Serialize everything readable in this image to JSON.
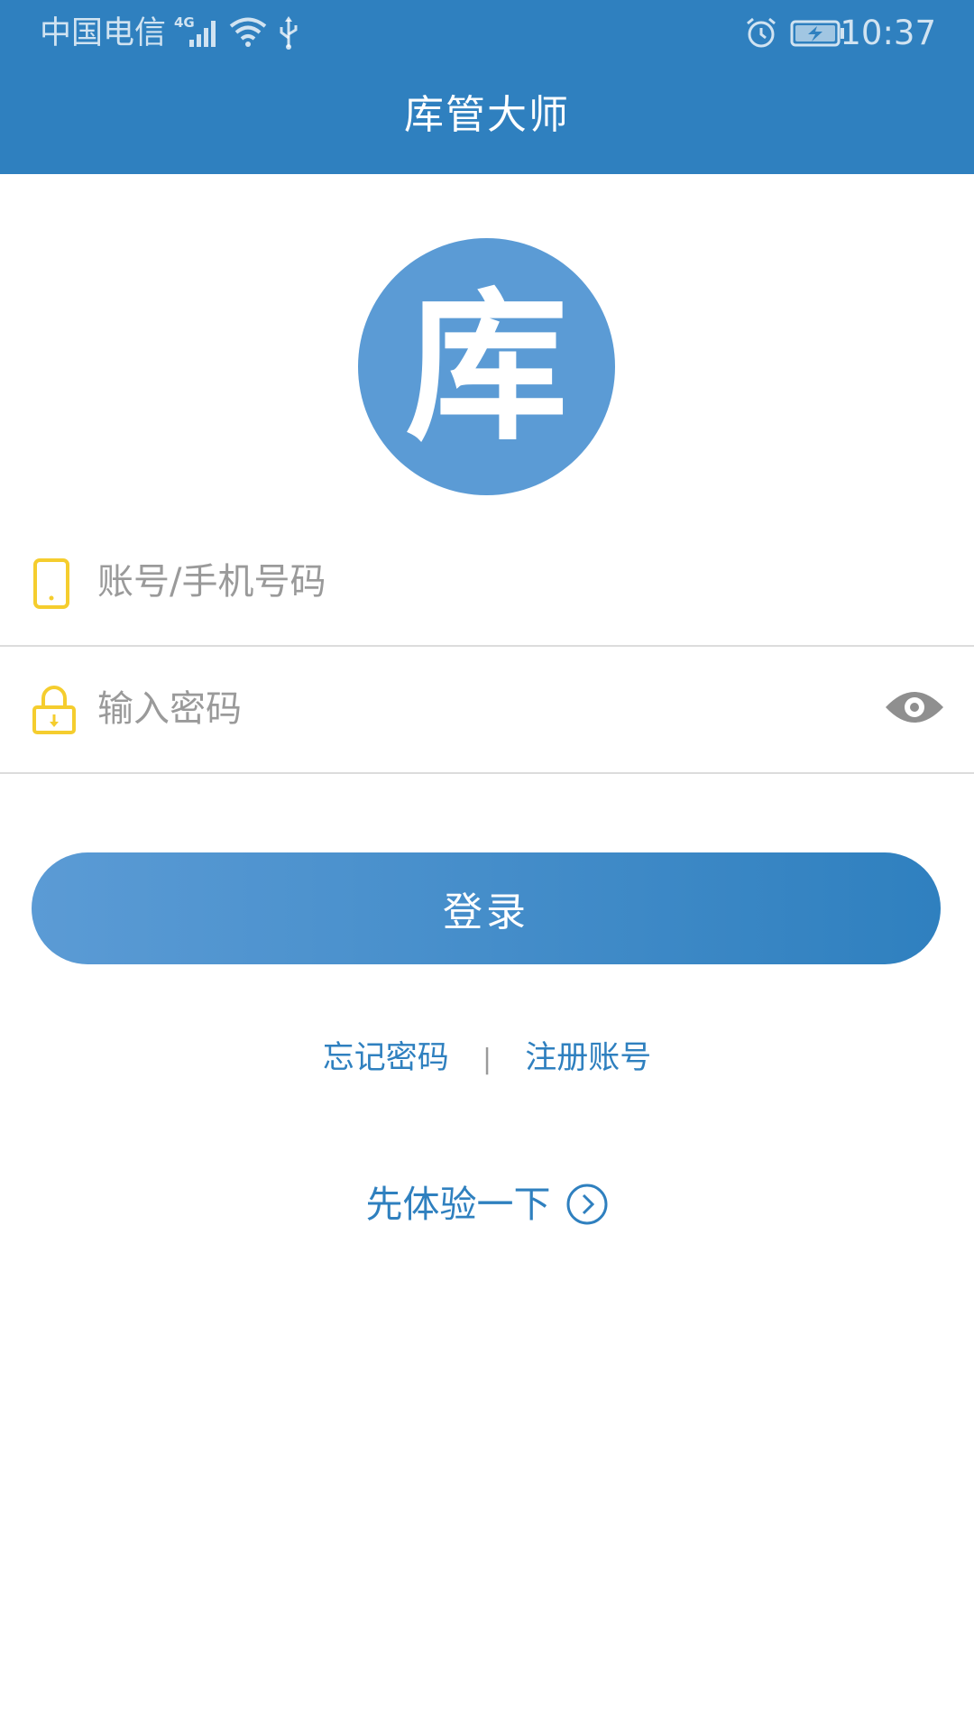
{
  "status_bar": {
    "carrier": "中国电信",
    "network": "4G",
    "time": "10:37"
  },
  "header": {
    "title": "库管大师"
  },
  "logo": {
    "text": "库"
  },
  "form": {
    "account_placeholder": "账号/手机号码",
    "password_placeholder": "输入密码",
    "login_label": "登录"
  },
  "links": {
    "forgot_password": "忘记密码",
    "separator": "|",
    "register": "注册账号"
  },
  "trial": {
    "label": "先体验一下"
  },
  "colors": {
    "primary": "#2f80bf",
    "logo_bg": "#5b9bd5",
    "icon_accent": "#f5cd2e",
    "placeholder": "#9a9a9a"
  }
}
